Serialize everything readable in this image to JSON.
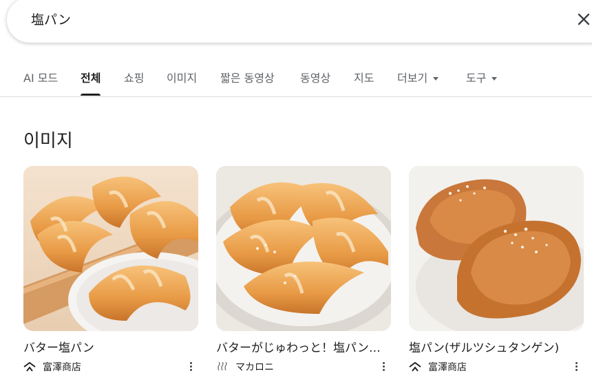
{
  "search": {
    "query": "塩パン"
  },
  "tabs": [
    {
      "label": "AI 모드"
    },
    {
      "label": "전체"
    },
    {
      "label": "쇼핑"
    },
    {
      "label": "이미지"
    },
    {
      "label": "짧은 동영상"
    },
    {
      "label": "동영상"
    },
    {
      "label": "지도"
    },
    {
      "label": "더보기"
    },
    {
      "label": "도구"
    }
  ],
  "section": {
    "title": "이미지"
  },
  "images": [
    {
      "title": "バター塩パン",
      "source": "富澤商店",
      "icon": "store-roof-icon"
    },
    {
      "title": "バターがじゅわっと！塩パン…",
      "source": "マカロニ",
      "icon": "steam-icon"
    },
    {
      "title": "塩パン(ザルツシュタンゲン)",
      "source": "富澤商店",
      "icon": "store-roof-icon"
    }
  ]
}
